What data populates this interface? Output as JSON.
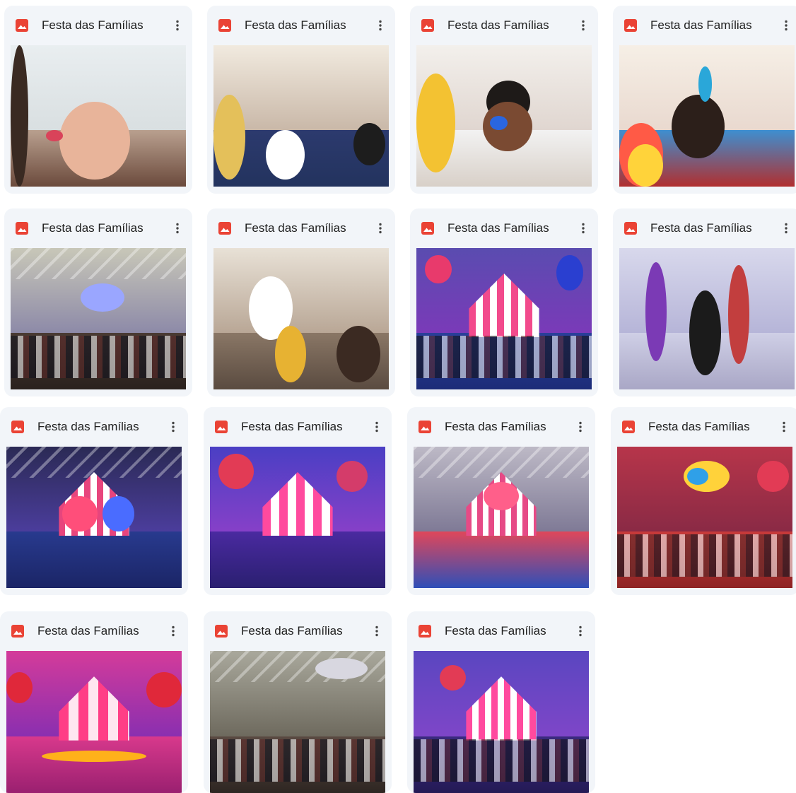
{
  "file_icon": "image-file-icon",
  "more_icon": "more-vert-icon",
  "colors": {
    "card_bg": "#f2f5f9",
    "image_icon": "#ea4335",
    "text": "#1f1f1f"
  },
  "files": [
    {
      "title": "Festa das Famílias",
      "scene": "face-paint-girl"
    },
    {
      "title": "Festa das Famílias",
      "scene": "face-paint-mats"
    },
    {
      "title": "Festa das Famílias",
      "scene": "face-paint-boy"
    },
    {
      "title": "Festa das Famílias",
      "scene": "face-paint-closeup"
    },
    {
      "title": "Festa das Famílias",
      "scene": "hall-audience"
    },
    {
      "title": "Festa das Famílias",
      "scene": "face-paint-group"
    },
    {
      "title": "Festa das Famílias",
      "scene": "stage-children"
    },
    {
      "title": "Festa das Famílias",
      "scene": "handstand"
    },
    {
      "title": "Festa das Famílias",
      "scene": "stilts-stage"
    },
    {
      "title": "Festa das Famílias",
      "scene": "clowns-stage"
    },
    {
      "title": "Festa das Famílias",
      "scene": "acrobats"
    },
    {
      "title": "Festa das Famílias",
      "scene": "parachute-dance"
    },
    {
      "title": "Festa das Famílias",
      "scene": "hula-hoop"
    },
    {
      "title": "Festa das Famílias",
      "scene": "hall-tables"
    },
    {
      "title": "Festa das Famílias",
      "scene": "group-photo"
    }
  ]
}
